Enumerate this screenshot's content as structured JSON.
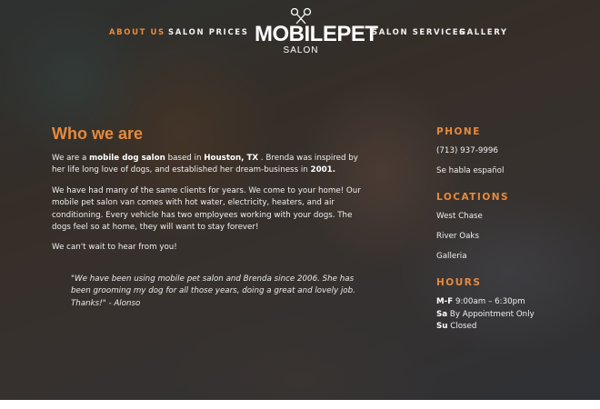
{
  "nav": {
    "about": "ABOUT US",
    "prices": "SALON PRICES",
    "services": "SALON SERVICES",
    "gallery": "GALLERY"
  },
  "logo": {
    "main": "MOBILEPET",
    "sub": "SALON"
  },
  "colors": {
    "accent": "#e88a3c"
  },
  "about": {
    "heading": "Who we are",
    "p1": {
      "t1": "We are a ",
      "b1": "mobile dog salon",
      "t2": " based in ",
      "b2": "Houston, TX",
      "t3": " . Brenda was inspired by her life long love of dogs, and established her dream-business in ",
      "b3": "2001."
    },
    "p2": "We have had many of the same clients for years. We come to your home! Our mobile pet salon van comes with  hot water, electricity, heaters, and air conditioning. Every vehicle has two employees working with your dogs. The dogs feel so at home, they will want to stay forever!",
    "p3": "We can't wait to hear from you!",
    "quote": "\"We have been using mobile pet salon and Brenda since 2006. She has been grooming my dog for all those years, doing a great and lovely job. Thanks!\" - Alonso"
  },
  "phone": {
    "title": "PHONE",
    "number": "(713) 937-9996",
    "note": "Se habla español"
  },
  "locations": {
    "title": "LOCATIONS",
    "items": [
      "West Chase",
      "River Oaks",
      "Galleria"
    ]
  },
  "hours": {
    "title": "HOURS",
    "rows": [
      {
        "day": "M-F",
        "time": " 9:00am – 6:30pm"
      },
      {
        "day": "Sa",
        "time": " By Appointment Only"
      },
      {
        "day": "Su",
        "time": " Closed"
      }
    ]
  }
}
